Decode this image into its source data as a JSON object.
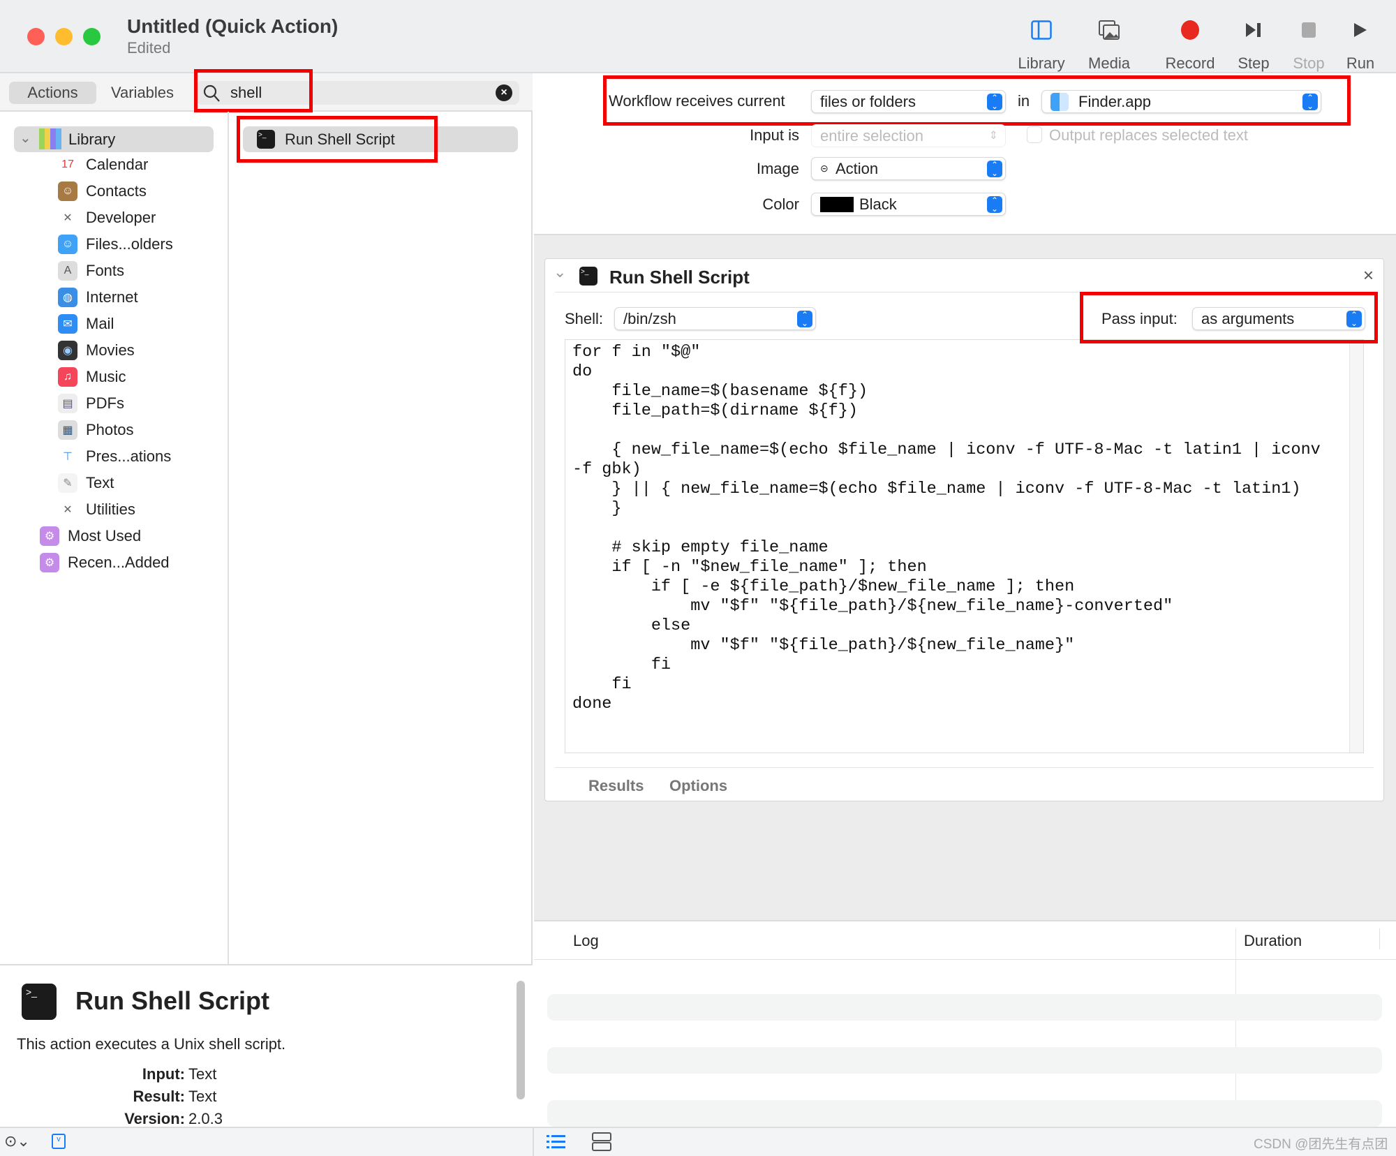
{
  "window": {
    "title": "Untitled (Quick Action)",
    "subtitle": "Edited"
  },
  "toolbar": [
    {
      "label": "Library",
      "icon": "sidebar-icon"
    },
    {
      "label": "Media",
      "icon": "photos-icon"
    },
    {
      "label": "Record",
      "icon": "record-icon"
    },
    {
      "label": "Step",
      "icon": "step-icon"
    },
    {
      "label": "Stop",
      "icon": "stop-icon"
    },
    {
      "label": "Run",
      "icon": "play-icon"
    }
  ],
  "tabs": {
    "actions": "Actions",
    "variables": "Variables"
  },
  "search": {
    "value": "shell"
  },
  "library": {
    "root": "Library",
    "items": [
      "Calendar",
      "Contacts",
      "Developer",
      "Files...olders",
      "Fonts",
      "Internet",
      "Mail",
      "Movies",
      "Music",
      "PDFs",
      "Photos",
      "Pres...ations",
      "Text",
      "Utilities"
    ],
    "extra": [
      "Most Used",
      "Recen...Added"
    ]
  },
  "results": [
    "Run Shell Script"
  ],
  "description": {
    "title": "Run Shell Script",
    "text": "This action executes a Unix shell script.",
    "input_label": "Input:",
    "input": "Text",
    "result_label": "Result:",
    "result": "Text",
    "version_label": "Version:",
    "version": "2.0.3"
  },
  "workflow": {
    "receives_label": "Workflow receives current",
    "receives": "files or folders",
    "in_label": "in",
    "app": "Finder.app",
    "input_is_label": "Input is",
    "input_is": "entire selection",
    "output_replaces": "Output replaces selected text",
    "image_label": "Image",
    "image": "Action",
    "color_label": "Color",
    "color": "Black"
  },
  "action": {
    "title": "Run Shell Script",
    "shell_label": "Shell:",
    "shell": "/bin/zsh",
    "pass_label": "Pass input:",
    "pass": "as arguments",
    "script": "for f in \"$@\"\ndo\n    file_name=$(basename ${f})\n    file_path=$(dirname ${f})\n\n    { new_file_name=$(echo $file_name | iconv -f UTF-8-Mac -t latin1 | iconv\n-f gbk)\n    } || { new_file_name=$(echo $file_name | iconv -f UTF-8-Mac -t latin1)\n    }\n\n    # skip empty file_name\n    if [ -n \"$new_file_name\" ]; then\n        if [ -e ${file_path}/$new_file_name ]; then\n            mv \"$f\" \"${file_path}/${new_file_name}-converted\"\n        else\n            mv \"$f\" \"${file_path}/${new_file_name}\"\n        fi\n    fi\ndone",
    "results_tab": "Results",
    "options_tab": "Options"
  },
  "log": {
    "log_header": "Log",
    "duration_header": "Duration"
  },
  "watermark": "CSDN @团先生有点团",
  "colors": {
    "highlight": "#f20000",
    "accent": "#1a7cf5",
    "record": "#e8291f"
  }
}
